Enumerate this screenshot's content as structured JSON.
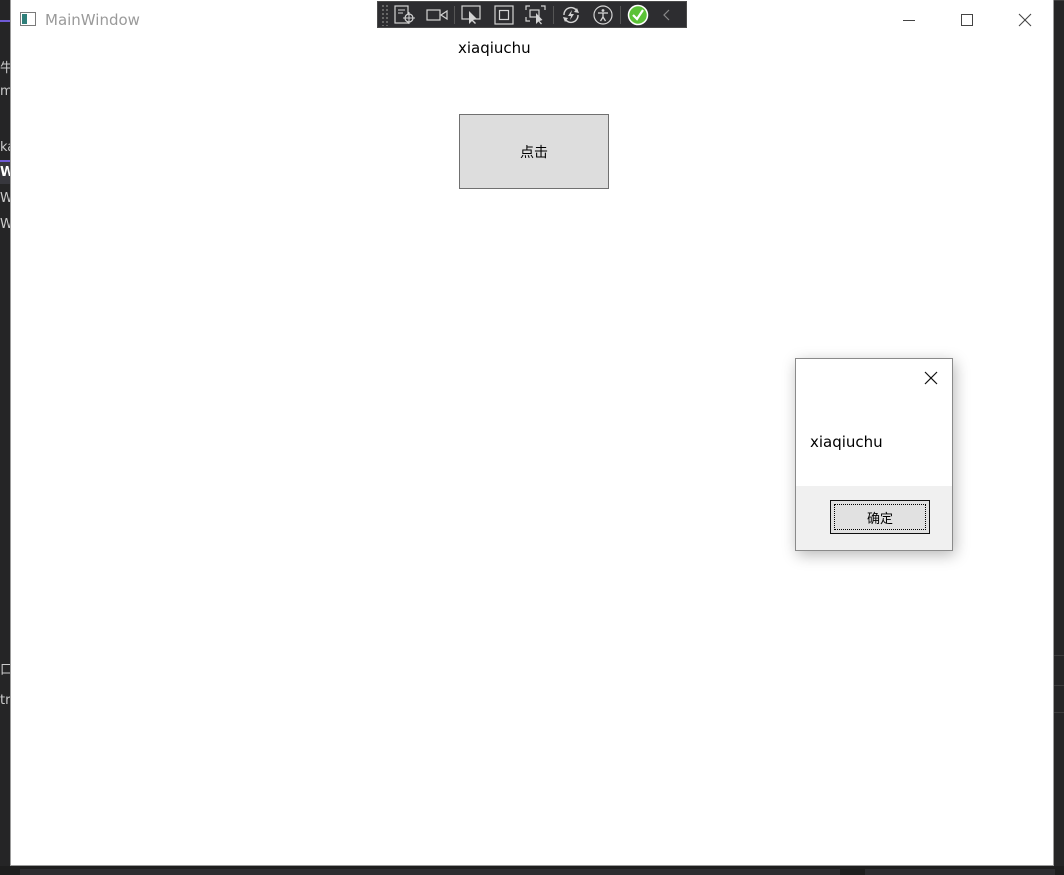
{
  "ide": {
    "left_fragments": [
      "牛",
      "m",
      "ka",
      "W",
      "W",
      "W",
      "口",
      "tr"
    ]
  },
  "window": {
    "title": "MainWindow",
    "icon": "app-window-icon",
    "controls": {
      "minimize_icon": "minimize-icon",
      "maximize_icon": "maximize-icon",
      "close_icon": "close-icon"
    }
  },
  "debug_toolbar": {
    "items": [
      "live-visual-tree-icon",
      "record-icon",
      "select-element-icon",
      "display-layout-adorners-icon",
      "track-focus-icon",
      "hot-reload-icon",
      "accessibility-icon",
      "binding-check-icon",
      "collapse-toolbar-icon"
    ],
    "check_color": "#5bc236"
  },
  "main": {
    "label_text": "xiaqiuchu",
    "button_label": "点击"
  },
  "message_box": {
    "text": "xiaqiuchu",
    "ok_label": "确定",
    "close_icon": "close-icon"
  }
}
